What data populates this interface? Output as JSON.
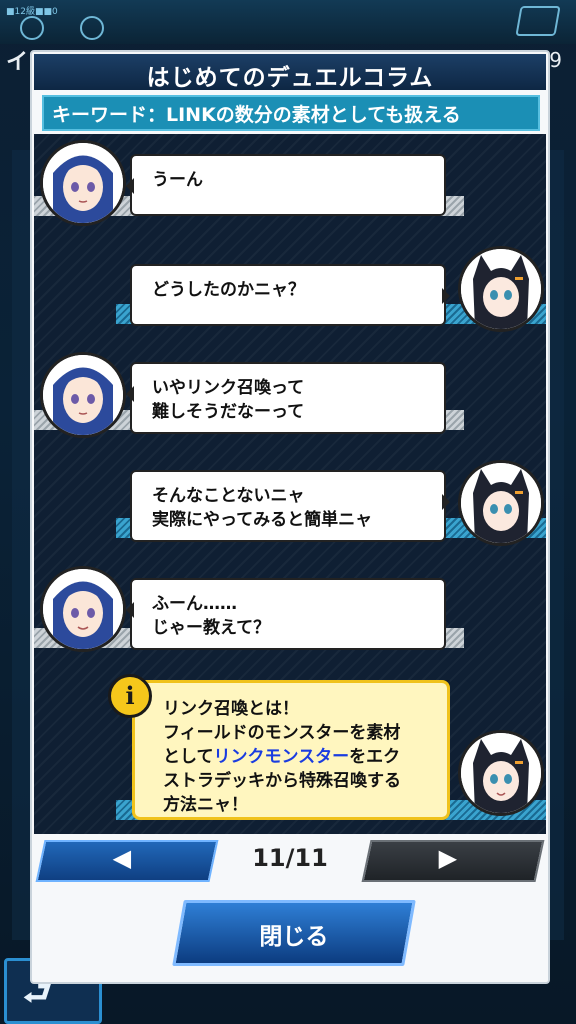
{
  "background": {
    "partial_title": "イン",
    "partial_number": "9",
    "top_small_text": "■12級■■0"
  },
  "dialog": {
    "title": "はじめてのデュエルコラム",
    "keyword": "キーワード：LINKの数分の素材としても扱える",
    "messages": [
      {
        "speaker": "girl",
        "line1": "うーん",
        "line2": ""
      },
      {
        "speaker": "cat",
        "line1": "どうしたのかニャ？",
        "line2": ""
      },
      {
        "speaker": "girl",
        "line1": "いやリンク召喚って",
        "line2": "難しそうだなーって"
      },
      {
        "speaker": "cat",
        "line1": "そんなことないニャ",
        "line2": "実際にやってみると簡単ニャ"
      },
      {
        "speaker": "girl",
        "line1": "ふーん……",
        "line2": "じゃー教えて？"
      }
    ],
    "info": {
      "icon_glyph": "i",
      "line1": "リンク召喚とは！",
      "line2": "フィールドのモンスターを素材",
      "line3_pre": "として",
      "line3_link": "リンクモンスター",
      "line3_post": "をエク",
      "line4": "ストラデッキから特殊召喚する",
      "line5": "方法ニャ！"
    },
    "pagination": {
      "current_label": "11/11",
      "prev_glyph": "◀",
      "next_glyph": "▶"
    },
    "close_label": "閉じる"
  },
  "colors": {
    "title_bar": "#1c3f66",
    "keyword_bg": "#1b8fb5",
    "info_bg": "#fff6bf",
    "info_border": "#f0c21b",
    "link_term": "#1a3ce0"
  },
  "icons": [
    "info-icon",
    "chevron-left-icon",
    "chevron-right-icon",
    "back-arrow-icon"
  ]
}
